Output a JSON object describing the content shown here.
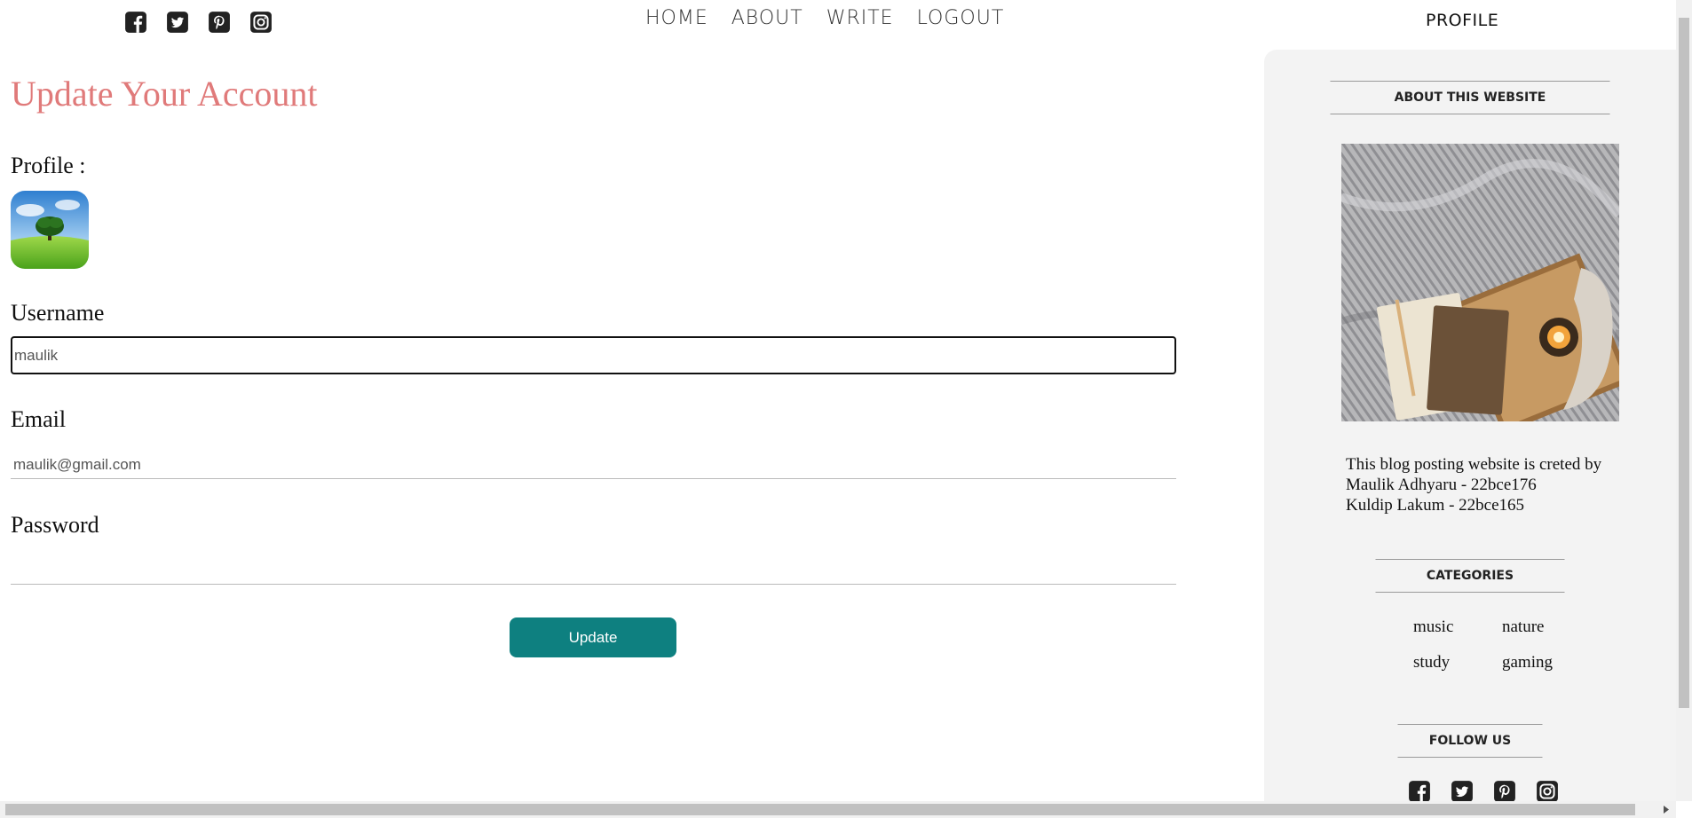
{
  "header": {
    "social_icons": [
      "facebook-square-icon",
      "twitter-square-icon",
      "pinterest-square-icon",
      "instagram-icon"
    ],
    "nav": {
      "home": "HOME",
      "about": "ABOUT",
      "write": "WRITE",
      "logout": "LOGOUT"
    },
    "profile": "PROFILE"
  },
  "form": {
    "title": "Update Your Account",
    "profile_label": "Profile :",
    "username_label": "Username",
    "username_value": "maulik",
    "email_label": "Email",
    "email_value": "maulik@gmail.com",
    "password_label": "Password",
    "password_value": "",
    "update_button": "Update"
  },
  "sidebar": {
    "about_title": "ABOUT THIS WEBSITE",
    "about_lines": [
      "This blog posting website is creted by",
      "Maulik Adhyaru - 22bce176",
      "Kuldip Lakum - 22bce165"
    ],
    "categories_title": "CATEGORIES",
    "categories": [
      "music",
      "nature",
      "study",
      "gaming"
    ],
    "follow_title": "FOLLOW US",
    "social_icons": [
      "facebook-square-icon",
      "twitter-square-icon",
      "pinterest-square-icon",
      "instagram-icon"
    ]
  },
  "colors": {
    "title": "#e07a7a",
    "button": "#0e8080",
    "sidebar_bg": "#f3f3f3"
  }
}
